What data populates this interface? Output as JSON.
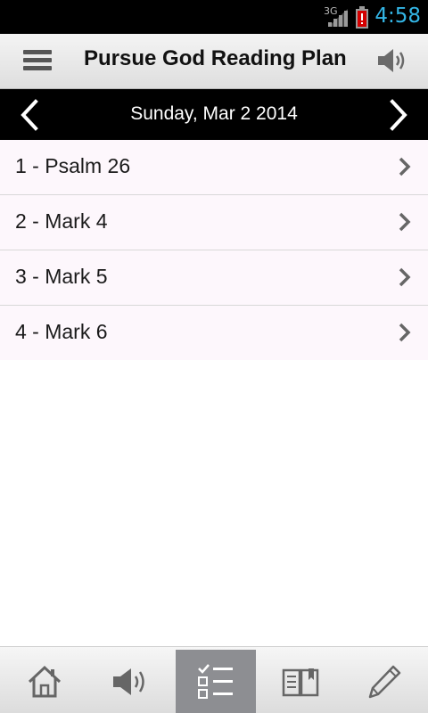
{
  "status_bar": {
    "network": "3G",
    "time": "4:58"
  },
  "header": {
    "title": "Pursue God Reading Plan",
    "menu_icon": "hamburger-menu-icon",
    "audio_icon": "speaker-icon"
  },
  "date_nav": {
    "date": "Sunday, Mar 2 2014",
    "prev_icon": "chevron-left-icon",
    "next_icon": "chevron-right-icon"
  },
  "readings": [
    {
      "label": "1 - Psalm 26"
    },
    {
      "label": "2 - Mark 4"
    },
    {
      "label": "3 - Mark 5"
    },
    {
      "label": "4 - Mark 6"
    }
  ],
  "tab_bar": {
    "tabs": [
      {
        "icon": "home-icon",
        "active": false
      },
      {
        "icon": "speaker-icon",
        "active": false
      },
      {
        "icon": "checklist-icon",
        "active": true
      },
      {
        "icon": "open-book-icon",
        "active": false
      },
      {
        "icon": "pencil-icon",
        "active": false
      }
    ],
    "active_color": "#8d8e92"
  },
  "colors": {
    "status_time": "#33b5e5",
    "battery_alert": "#d40000",
    "list_background": "#fdf7fc"
  }
}
